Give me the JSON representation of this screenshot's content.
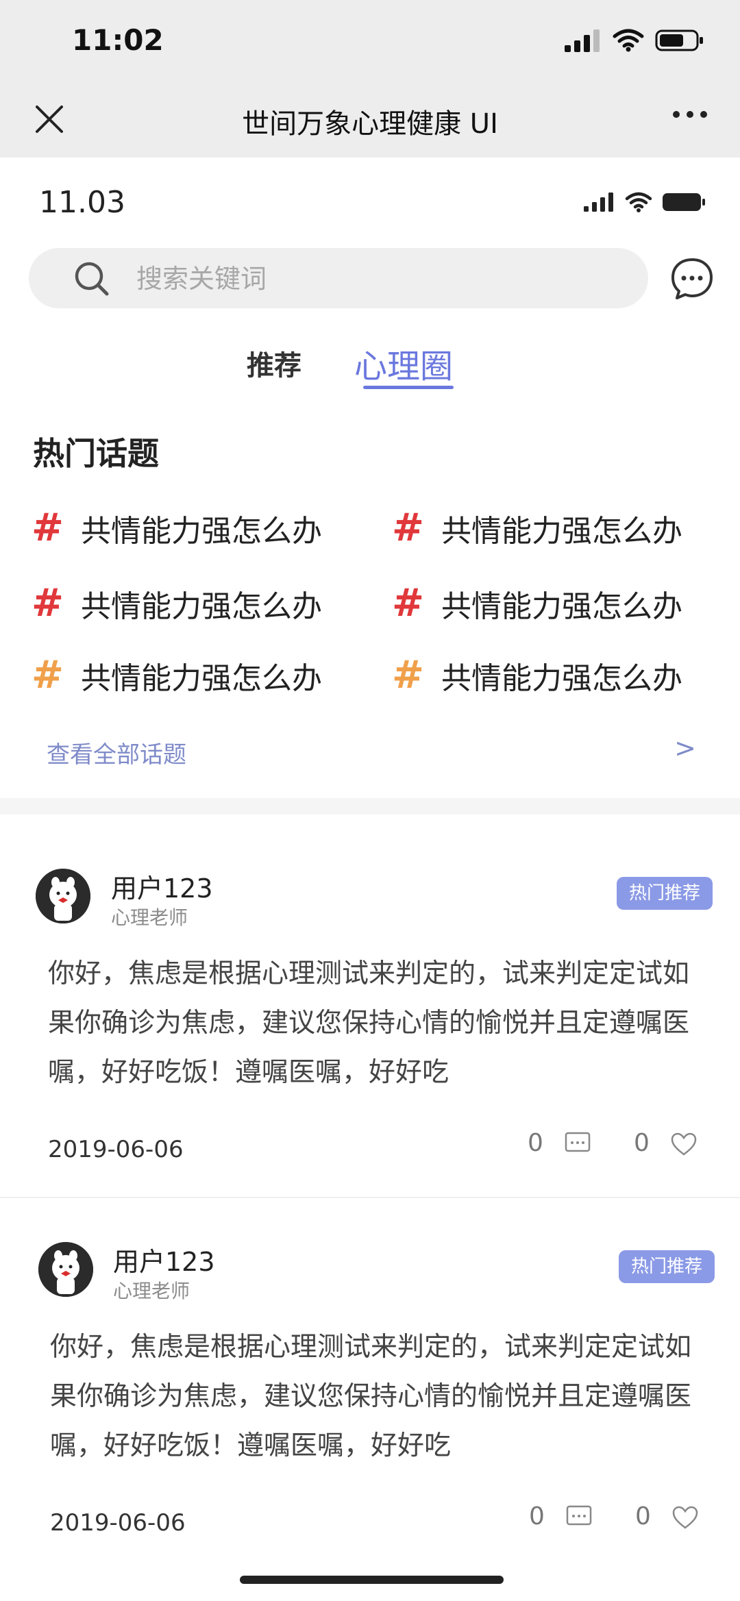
{
  "outer": {
    "time": "11:02",
    "title": "世间万象心理健康 UI"
  },
  "inner": {
    "time": "11.03"
  },
  "search": {
    "placeholder": "搜索关键词"
  },
  "tabs": [
    {
      "label": "推荐",
      "active": false
    },
    {
      "label": "心理圈",
      "active": true
    }
  ],
  "hot_topics": {
    "title": "热门话题",
    "items": [
      {
        "hash": "#",
        "text": "共情能力强怎么办",
        "color": "#e0383b"
      },
      {
        "hash": "#",
        "text": "共情能力强怎么办",
        "color": "#e0383b"
      },
      {
        "hash": "#",
        "text": "共情能力强怎么办",
        "color": "#e0383b"
      },
      {
        "hash": "#",
        "text": "共情能力强怎么办",
        "color": "#e0383b"
      },
      {
        "hash": "#",
        "text": "共情能力强怎么办",
        "color": "#f0a04b"
      },
      {
        "hash": "#",
        "text": "共情能力强怎么办",
        "color": "#f0a04b"
      }
    ],
    "see_all": "查看全部话题",
    "see_all_arrow": ">"
  },
  "posts": [
    {
      "user": "用户123",
      "role": "心理老师",
      "badge": "热门推荐",
      "body": "你好，焦虑是根据心理测试来判定的，试来判定定试如果你确诊为焦虑，建议您保持心情的愉悦并且定遵嘱医嘱，好好吃饭！遵嘱医嘱，好好吃",
      "date": "2019-06-06",
      "comments": "0",
      "likes": "0"
    },
    {
      "user": "用户123",
      "role": "心理老师",
      "badge": "热门推荐",
      "body": "你好，焦虑是根据心理测试来判定的，试来判定定试如果你确诊为焦虑，建议您保持心情的愉悦并且定遵嘱医嘱，好好吃饭！遵嘱医嘱，好好吃",
      "date": "2019-06-06",
      "comments": "0",
      "likes": "0"
    }
  ],
  "colors": {
    "accent": "#6b78de",
    "badge": "#8b9ae6",
    "hash_red": "#e0383b",
    "hash_orange": "#f0a04b"
  }
}
